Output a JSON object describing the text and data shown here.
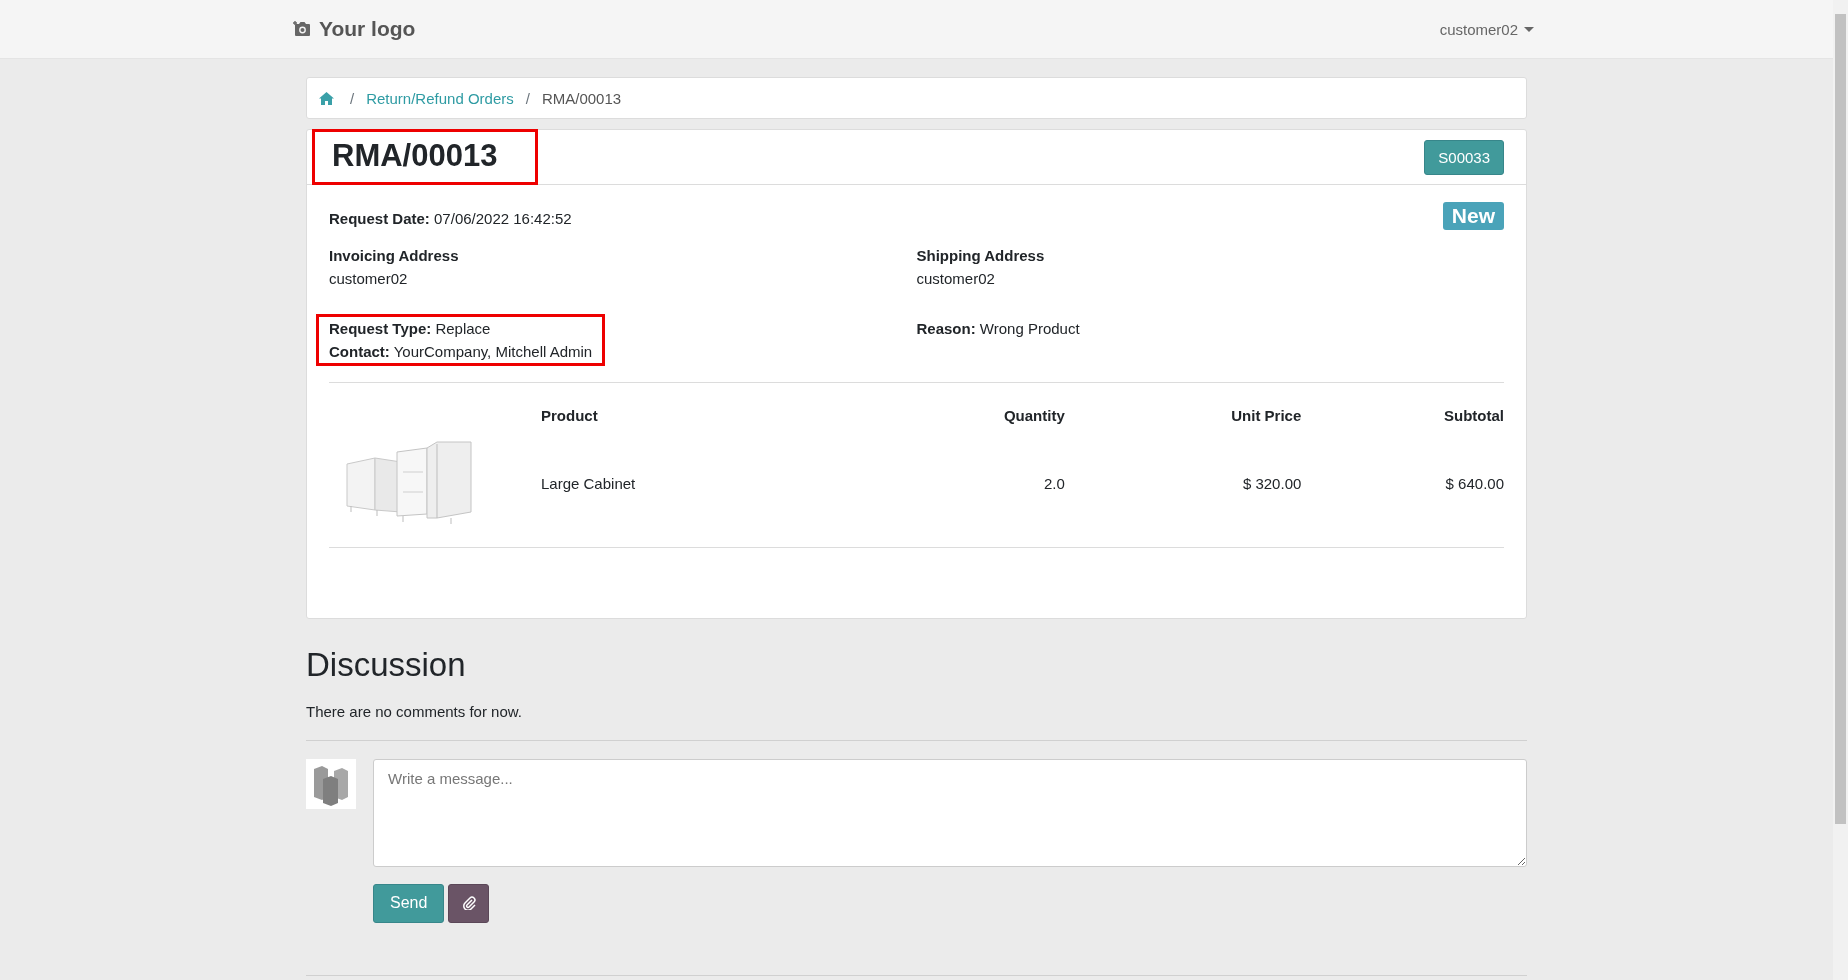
{
  "navbar": {
    "logo": "Your logo",
    "user": "customer02"
  },
  "breadcrumb": [
    {
      "separator": "/",
      "label": "Return/Refund Orders",
      "link": true
    },
    {
      "separator": "/",
      "label": "RMA/00013",
      "link": false
    }
  ],
  "order": {
    "title": "RMA/00013",
    "title_highlighted": true,
    "sale_order": "S00033",
    "status": "New",
    "request_date": {
      "label": "Request Date:",
      "value": "07/06/2022 16:42:52"
    },
    "invoicing": {
      "label": "Invoicing Address",
      "value": "customer02"
    },
    "shipping": {
      "label": "Shipping Address",
      "value": "customer02"
    },
    "details": {
      "highlighted": true,
      "fields": [
        {
          "label": "Request Type:",
          "value": "Replace"
        },
        {
          "label": "Contact:",
          "value": "YourCompany, Mitchell Admin"
        }
      ]
    },
    "reason": {
      "label": "Reason:",
      "value": "Wrong Product"
    },
    "columns": [
      "Product",
      "Quantity",
      "Unit Price",
      "Subtotal"
    ],
    "lines": [
      {
        "product": "Large Cabinet",
        "quantity": "2.0",
        "unit_price": "$ 320.00",
        "subtotal": "$ 640.00"
      }
    ]
  },
  "discussion": {
    "title": "Discussion",
    "empty_text": "There are no comments for now.",
    "placeholder": "Write a message...",
    "send": "Send"
  }
}
